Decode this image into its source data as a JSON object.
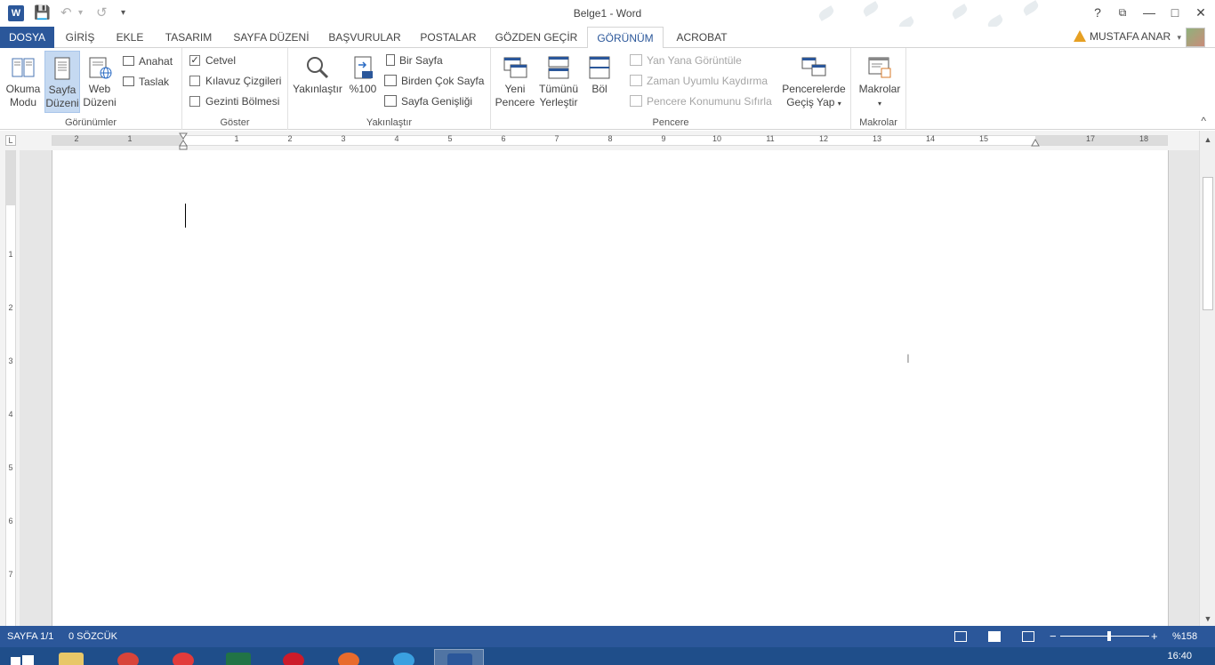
{
  "window": {
    "title": "Belge1 - Word",
    "help": "?",
    "ribbon_display": "⧉",
    "minimize": "—",
    "maximize": "□",
    "close": "✕"
  },
  "qat": {
    "app_icon": "W",
    "save_icon": "💾",
    "undo_icon": "↶",
    "undo_dropdown": "▾",
    "redo_icon": "↺",
    "customize_icon": "▾"
  },
  "tabs": [
    {
      "label": "DOSYA"
    },
    {
      "label": "GİRİŞ"
    },
    {
      "label": "EKLE"
    },
    {
      "label": "TASARIM"
    },
    {
      "label": "SAYFA DÜZENİ"
    },
    {
      "label": "BAŞVURULAR"
    },
    {
      "label": "POSTALAR"
    },
    {
      "label": "GÖZDEN GEÇİR"
    },
    {
      "label": "GÖRÜNÜM"
    },
    {
      "label": "ACROBAT"
    }
  ],
  "user": {
    "name": "MUSTAFA ANAR",
    "dropdown": "▾"
  },
  "ribbon": {
    "views": {
      "label": "Görünümler",
      "read_mode": "Okuma Modu",
      "print_layout": "Sayfa Düzeni",
      "web_layout": "Web Düzeni",
      "outline": "Anahat",
      "draft": "Taslak"
    },
    "show": {
      "label": "Göster",
      "ruler": "Cetvel",
      "ruler_checked": "✓",
      "gridlines": "Kılavuz Çizgileri",
      "nav_pane": "Gezinti Bölmesi"
    },
    "zoom": {
      "label": "Yakınlaştır",
      "zoom": "Yakınlaştır",
      "hundred": "%100",
      "one_page": "Bir Sayfa",
      "multi_page": "Birden Çok Sayfa",
      "page_width": "Sayfa Genişliği"
    },
    "window": {
      "label": "Pencere",
      "new_window": "Yeni Pencere",
      "arrange_all": "Tümünü Yerleştir",
      "split": "Böl",
      "side_by_side": "Yan Yana Görüntüle",
      "sync_scroll": "Zaman Uyumlu Kaydırma",
      "reset_position": "Pencere Konumunu Sıfırla",
      "switch_windows": "Pencerelerde Geçiş Yap",
      "switch_dropdown": "▾"
    },
    "macros": {
      "label": "Makrolar",
      "macros": "Makrolar",
      "dropdown": "▾"
    },
    "collapse": "^"
  },
  "ruler": {
    "tab_selector": "L",
    "h_numbers": [
      "2",
      "1",
      "1",
      "2",
      "3",
      "4",
      "5",
      "6",
      "7",
      "8",
      "9",
      "10",
      "11",
      "12",
      "13",
      "14",
      "15",
      "17",
      "18"
    ],
    "v_numbers": [
      "1",
      "2",
      "3",
      "4",
      "5",
      "6",
      "7"
    ]
  },
  "scroll": {
    "up": "▲",
    "down": "▼"
  },
  "status": {
    "page": "SAYFA 1/1",
    "words": "0 SÖZCÜK",
    "zoom_minus": "−",
    "zoom_plus": "+",
    "zoom": "%158"
  },
  "taskbar": {
    "clock": "16:40"
  },
  "colors": {
    "accent": "#2b579a"
  }
}
